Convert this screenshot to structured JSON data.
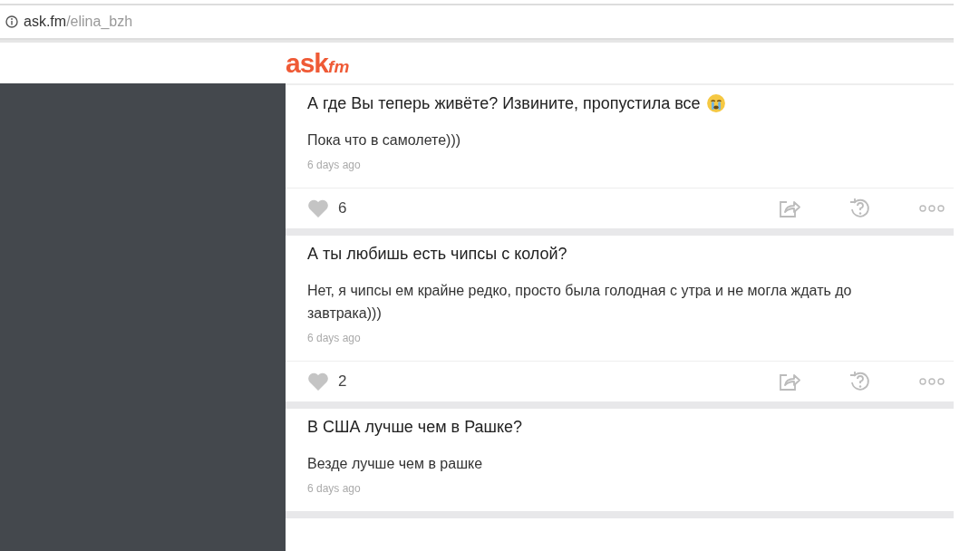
{
  "address_bar": {
    "host": "ask.fm",
    "path": "/elina_bzh"
  },
  "logo": {
    "main": "ask",
    "suffix": "fm"
  },
  "answers": [
    {
      "question": "А где Вы теперь живёте? Извините, пропустила все",
      "question_emoji": true,
      "answer": "Пока что в самолете)))",
      "time": "6 days ago",
      "likes": "6",
      "actions": true
    },
    {
      "question": "А ты любишь есть чипсы с колой?",
      "question_emoji": false,
      "answer": "Нет, я чипсы ем крайне редко, просто была голодная с утра и не могла ждать до завтрака)))",
      "time": "6 days ago",
      "likes": "2",
      "actions": true
    },
    {
      "question": "В США лучше чем в Рашке?",
      "question_emoji": false,
      "answer": "Везде лучше чем в рашке",
      "time": "6 days ago",
      "actions": false
    }
  ]
}
